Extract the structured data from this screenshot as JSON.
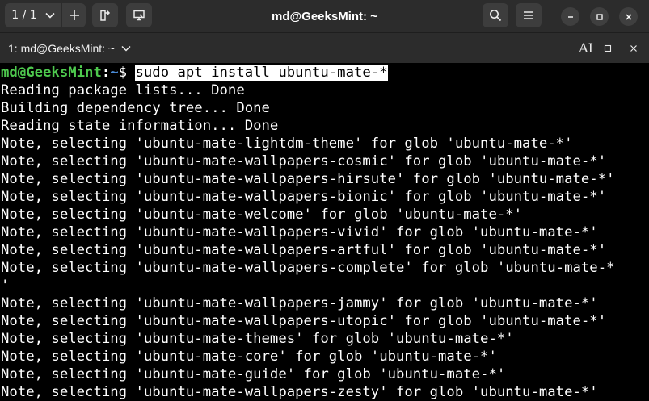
{
  "titlebar": {
    "tab_counter": "1 / 1",
    "title": "md@GeeksMint: ~",
    "icons": {
      "dropdown": "chevron-down-icon",
      "add": "plus-icon",
      "detach": "detach-tab-icon",
      "present": "present-icon",
      "search": "search-icon",
      "menu": "hamburger-menu-icon",
      "minimize": "minimize-icon",
      "maximize": "maximize-icon",
      "close": "close-icon"
    }
  },
  "tabbar": {
    "tab_label": "1: md@GeeksMint: ~",
    "font_button": "AI",
    "icons": {
      "dropdown": "chevron-down-icon",
      "font": "font-cursor-icon",
      "maximize": "maximize-icon",
      "close": "close-icon"
    }
  },
  "terminal": {
    "prompt": {
      "user": "md@GeeksMint",
      "separator": ":",
      "path": "~",
      "symbol": "$ "
    },
    "command": "sudo apt install ubuntu-mate-*",
    "output": [
      "Reading package lists... Done",
      "Building dependency tree... Done",
      "Reading state information... Done",
      "Note, selecting 'ubuntu-mate-lightdm-theme' for glob 'ubuntu-mate-*'",
      "Note, selecting 'ubuntu-mate-wallpapers-cosmic' for glob 'ubuntu-mate-*'",
      "Note, selecting 'ubuntu-mate-wallpapers-hirsute' for glob 'ubuntu-mate-*'",
      "Note, selecting 'ubuntu-mate-wallpapers-bionic' for glob 'ubuntu-mate-*'",
      "Note, selecting 'ubuntu-mate-welcome' for glob 'ubuntu-mate-*'",
      "Note, selecting 'ubuntu-mate-wallpapers-vivid' for glob 'ubuntu-mate-*'",
      "Note, selecting 'ubuntu-mate-wallpapers-artful' for glob 'ubuntu-mate-*'",
      "Note, selecting 'ubuntu-mate-wallpapers-complete' for glob 'ubuntu-mate-*",
      "'",
      "Note, selecting 'ubuntu-mate-wallpapers-jammy' for glob 'ubuntu-mate-*'",
      "Note, selecting 'ubuntu-mate-wallpapers-utopic' for glob 'ubuntu-mate-*'",
      "Note, selecting 'ubuntu-mate-themes' for glob 'ubuntu-mate-*'",
      "Note, selecting 'ubuntu-mate-core' for glob 'ubuntu-mate-*'",
      "Note, selecting 'ubuntu-mate-guide' for glob 'ubuntu-mate-*'",
      "Note, selecting 'ubuntu-mate-wallpapers-zesty' for glob 'ubuntu-mate-*'"
    ]
  },
  "colors": {
    "titlebar_bg": "#2c2c2c",
    "button_bg": "#3d3d3d",
    "terminal_bg": "#000000",
    "terminal_fg": "#ffffff",
    "prompt_user": "#4ec94e",
    "prompt_path": "#4a8ad6",
    "selection_bg": "#ffffff"
  }
}
